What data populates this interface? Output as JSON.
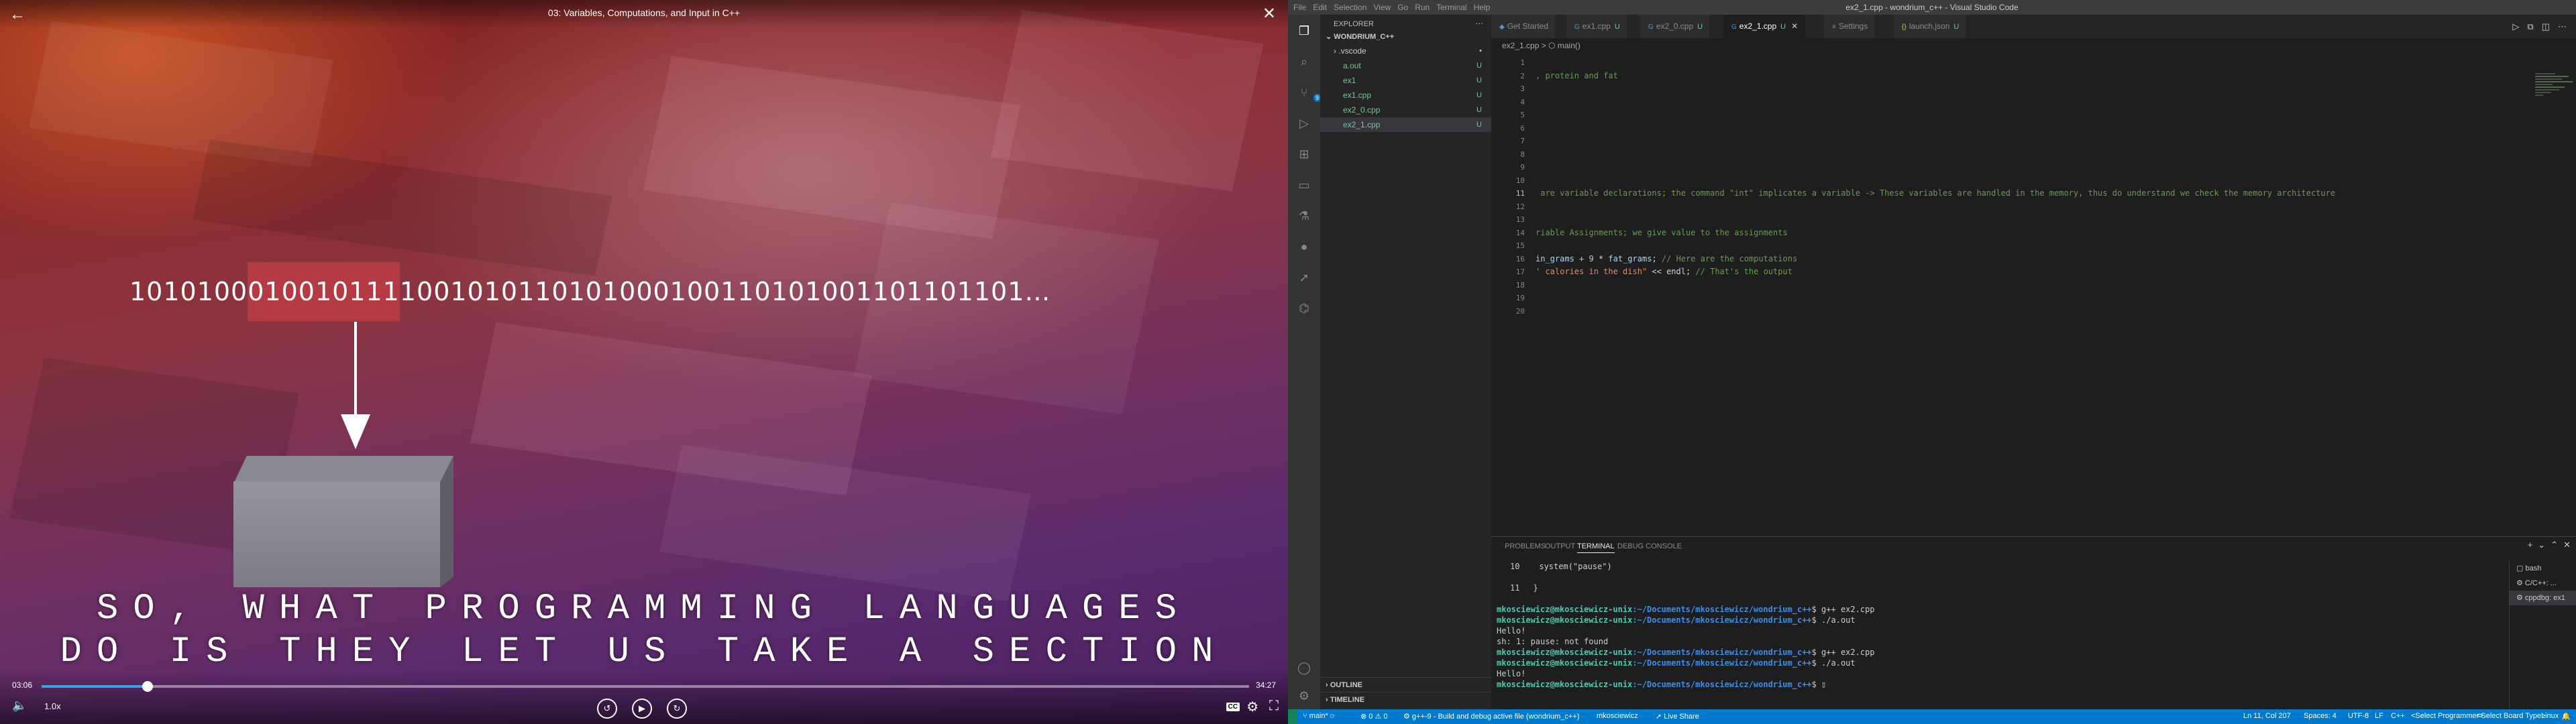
{
  "player": {
    "title": "03: Variables, Computations, and Input in C++",
    "binary_before": "1010100",
    "binary_highlight": "010010111",
    "binary_after": "1001010110101000100110101001101101101…",
    "caption_line1": "SO, WHAT PROGRAMMING LANGUAGES",
    "caption_line2": "DO IS THEY LET US TAKE A SECTION",
    "time_current": "03:06",
    "time_total": "34:27",
    "progress_percent": 8.8,
    "speed_label": "1.0x",
    "cc_label": "CC",
    "icons": {
      "back": "back-arrow-icon",
      "close": "close-icon",
      "volume": "volume-icon",
      "rewind": "rewind-10-icon",
      "play": "play-icon",
      "forward": "forward-10-icon",
      "settings": "gear-icon",
      "fullscreen": "fullscreen-icon"
    }
  },
  "vscode": {
    "window_title": "ex2_1.cpp - wondrium_c++ - Visual Studio Code",
    "menu": [
      "File",
      "Edit",
      "Selection",
      "View",
      "Go",
      "Run",
      "Terminal",
      "Help"
    ],
    "explorer_title": "EXPLORER",
    "folder_name": "WONDRIUM_C++",
    "files": [
      {
        "name": ".vscode",
        "decoration": "•",
        "folder": true
      },
      {
        "name": "a.out",
        "decoration": "U"
      },
      {
        "name": "ex1",
        "decoration": "U"
      },
      {
        "name": "ex1.cpp",
        "decoration": "U"
      },
      {
        "name": "ex2_0.cpp",
        "decoration": "U"
      },
      {
        "name": "ex2_1.cpp",
        "decoration": "U"
      }
    ],
    "outline_label": "OUTLINE",
    "timeline_label": "TIMELINE",
    "tabs": [
      {
        "label": "Get Started",
        "suffix": ""
      },
      {
        "label": "ex1.cpp",
        "suffix": "U"
      },
      {
        "label": "ex2_0.cpp",
        "suffix": "U"
      },
      {
        "label": "ex2_1.cpp",
        "suffix": "U"
      },
      {
        "label": "Settings",
        "suffix": ""
      },
      {
        "label": "launch.json",
        "suffix": "U"
      }
    ],
    "breadcrumb": "ex2_1.cpp > ⬡ main()",
    "code_lines": [
      {
        "n": "1",
        "text": ""
      },
      {
        "n": "2",
        "text": ", protein and fat",
        "kind": "cm"
      },
      {
        "n": "3",
        "text": ""
      },
      {
        "n": "4",
        "text": ""
      },
      {
        "n": "5",
        "text": ""
      },
      {
        "n": "6",
        "text": ""
      },
      {
        "n": "7",
        "text": ""
      },
      {
        "n": "8",
        "text": ""
      },
      {
        "n": "9",
        "text": ""
      },
      {
        "n": "10",
        "text": ""
      },
      {
        "n": "11",
        "text": " are variable declarations; the command \"int\" implicates a variable -> These variables are handled in the memory, thus do understand we check the memory architecture",
        "kind": "cm"
      },
      {
        "n": "12",
        "text": ""
      },
      {
        "n": "13",
        "text": ""
      },
      {
        "n": "14",
        "text": "riable Assignments; we give value to the assignments",
        "kind": "cm"
      },
      {
        "n": "15",
        "text": ""
      },
      {
        "n": "16",
        "text": ""
      },
      {
        "n": "17",
        "text": ""
      },
      {
        "n": "18",
        "text": ""
      },
      {
        "n": "19",
        "text": ""
      },
      {
        "n": "20",
        "text": ""
      }
    ],
    "line16": {
      "a": "in_grams",
      "b": " + ",
      "c": "9",
      "d": " * ",
      "e": "fat_grams",
      "f": "; ",
      "g": "// Here are the computations"
    },
    "line17": {
      "a": "' calories in the dish\"",
      "b": " << endl; ",
      "c": "// That's the output"
    },
    "panel_tabs": [
      "PROBLEMS",
      "OUTPUT",
      "TERMINAL",
      "DEBUG CONSOLE"
    ],
    "term_snippet": {
      "n10": "10",
      "l10": "    system(\"pause\")",
      "n11": "11",
      "l11": "}"
    },
    "terminal": [
      {
        "user": "mkosciewicz@mkosciewicz-unix",
        "path": ":~/Documents/mkosciewicz/wondrium_c++",
        "cmd": "$ g++ ex2.cpp"
      },
      {
        "user": "mkosciewicz@mkosciewicz-unix",
        "path": ":~/Documents/mkosciewicz/wondrium_c++",
        "cmd": "$ ./a.out"
      },
      {
        "plain": "Hello!"
      },
      {
        "plain": "sh: 1: pause: not found"
      },
      {
        "user": "mkosciewicz@mkosciewicz-unix",
        "path": ":~/Documents/mkosciewicz/wondrium_c++",
        "cmd": "$ g++ ex2.cpp"
      },
      {
        "user": "mkosciewicz@mkosciewicz-unix",
        "path": ":~/Documents/mkosciewicz/wondrium_c++",
        "cmd": "$ ./a.out"
      },
      {
        "plain": "Hello!"
      },
      {
        "user": "mkosciewicz@mkosciewicz-unix",
        "path": ":~/Documents/mkosciewicz/wondrium_c++",
        "cmd": "$ ▯"
      }
    ],
    "terminal_list": [
      "bash",
      "C/C++: ...",
      "cppdbg: ex1"
    ],
    "status": {
      "branch": "main*",
      "problems": "⊗ 0 ⚠ 0",
      "build": "g++-9 - Build and debug active file (wondrium_c++)",
      "user": "mkosciewicz",
      "liveshare": "Live Share",
      "position": "Ln 11, Col 207",
      "spaces": "Spaces: 4",
      "encoding": "UTF-8",
      "eol": "LF",
      "language": "C++",
      "programmer": "<Select Programmer>",
      "board": "<Select Board Type>",
      "os": "Linux"
    },
    "accent": "#007acc"
  }
}
